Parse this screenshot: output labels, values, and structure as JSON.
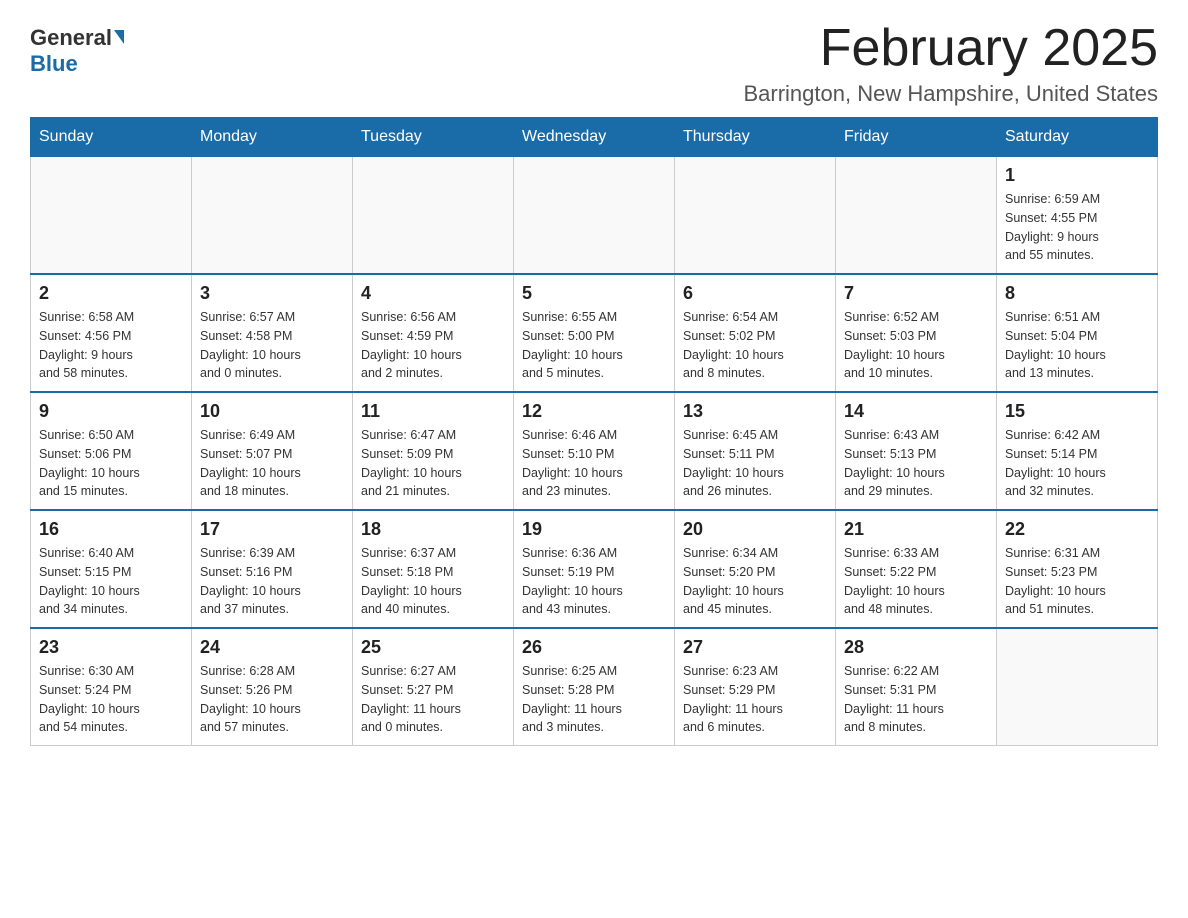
{
  "logo": {
    "general": "General",
    "blue": "Blue"
  },
  "title": "February 2025",
  "location": "Barrington, New Hampshire, United States",
  "weekdays": [
    "Sunday",
    "Monday",
    "Tuesday",
    "Wednesday",
    "Thursday",
    "Friday",
    "Saturday"
  ],
  "weeks": [
    [
      {
        "day": "",
        "info": ""
      },
      {
        "day": "",
        "info": ""
      },
      {
        "day": "",
        "info": ""
      },
      {
        "day": "",
        "info": ""
      },
      {
        "day": "",
        "info": ""
      },
      {
        "day": "",
        "info": ""
      },
      {
        "day": "1",
        "info": "Sunrise: 6:59 AM\nSunset: 4:55 PM\nDaylight: 9 hours\nand 55 minutes."
      }
    ],
    [
      {
        "day": "2",
        "info": "Sunrise: 6:58 AM\nSunset: 4:56 PM\nDaylight: 9 hours\nand 58 minutes."
      },
      {
        "day": "3",
        "info": "Sunrise: 6:57 AM\nSunset: 4:58 PM\nDaylight: 10 hours\nand 0 minutes."
      },
      {
        "day": "4",
        "info": "Sunrise: 6:56 AM\nSunset: 4:59 PM\nDaylight: 10 hours\nand 2 minutes."
      },
      {
        "day": "5",
        "info": "Sunrise: 6:55 AM\nSunset: 5:00 PM\nDaylight: 10 hours\nand 5 minutes."
      },
      {
        "day": "6",
        "info": "Sunrise: 6:54 AM\nSunset: 5:02 PM\nDaylight: 10 hours\nand 8 minutes."
      },
      {
        "day": "7",
        "info": "Sunrise: 6:52 AM\nSunset: 5:03 PM\nDaylight: 10 hours\nand 10 minutes."
      },
      {
        "day": "8",
        "info": "Sunrise: 6:51 AM\nSunset: 5:04 PM\nDaylight: 10 hours\nand 13 minutes."
      }
    ],
    [
      {
        "day": "9",
        "info": "Sunrise: 6:50 AM\nSunset: 5:06 PM\nDaylight: 10 hours\nand 15 minutes."
      },
      {
        "day": "10",
        "info": "Sunrise: 6:49 AM\nSunset: 5:07 PM\nDaylight: 10 hours\nand 18 minutes."
      },
      {
        "day": "11",
        "info": "Sunrise: 6:47 AM\nSunset: 5:09 PM\nDaylight: 10 hours\nand 21 minutes."
      },
      {
        "day": "12",
        "info": "Sunrise: 6:46 AM\nSunset: 5:10 PM\nDaylight: 10 hours\nand 23 minutes."
      },
      {
        "day": "13",
        "info": "Sunrise: 6:45 AM\nSunset: 5:11 PM\nDaylight: 10 hours\nand 26 minutes."
      },
      {
        "day": "14",
        "info": "Sunrise: 6:43 AM\nSunset: 5:13 PM\nDaylight: 10 hours\nand 29 minutes."
      },
      {
        "day": "15",
        "info": "Sunrise: 6:42 AM\nSunset: 5:14 PM\nDaylight: 10 hours\nand 32 minutes."
      }
    ],
    [
      {
        "day": "16",
        "info": "Sunrise: 6:40 AM\nSunset: 5:15 PM\nDaylight: 10 hours\nand 34 minutes."
      },
      {
        "day": "17",
        "info": "Sunrise: 6:39 AM\nSunset: 5:16 PM\nDaylight: 10 hours\nand 37 minutes."
      },
      {
        "day": "18",
        "info": "Sunrise: 6:37 AM\nSunset: 5:18 PM\nDaylight: 10 hours\nand 40 minutes."
      },
      {
        "day": "19",
        "info": "Sunrise: 6:36 AM\nSunset: 5:19 PM\nDaylight: 10 hours\nand 43 minutes."
      },
      {
        "day": "20",
        "info": "Sunrise: 6:34 AM\nSunset: 5:20 PM\nDaylight: 10 hours\nand 45 minutes."
      },
      {
        "day": "21",
        "info": "Sunrise: 6:33 AM\nSunset: 5:22 PM\nDaylight: 10 hours\nand 48 minutes."
      },
      {
        "day": "22",
        "info": "Sunrise: 6:31 AM\nSunset: 5:23 PM\nDaylight: 10 hours\nand 51 minutes."
      }
    ],
    [
      {
        "day": "23",
        "info": "Sunrise: 6:30 AM\nSunset: 5:24 PM\nDaylight: 10 hours\nand 54 minutes."
      },
      {
        "day": "24",
        "info": "Sunrise: 6:28 AM\nSunset: 5:26 PM\nDaylight: 10 hours\nand 57 minutes."
      },
      {
        "day": "25",
        "info": "Sunrise: 6:27 AM\nSunset: 5:27 PM\nDaylight: 11 hours\nand 0 minutes."
      },
      {
        "day": "26",
        "info": "Sunrise: 6:25 AM\nSunset: 5:28 PM\nDaylight: 11 hours\nand 3 minutes."
      },
      {
        "day": "27",
        "info": "Sunrise: 6:23 AM\nSunset: 5:29 PM\nDaylight: 11 hours\nand 6 minutes."
      },
      {
        "day": "28",
        "info": "Sunrise: 6:22 AM\nSunset: 5:31 PM\nDaylight: 11 hours\nand 8 minutes."
      },
      {
        "day": "",
        "info": ""
      }
    ]
  ]
}
